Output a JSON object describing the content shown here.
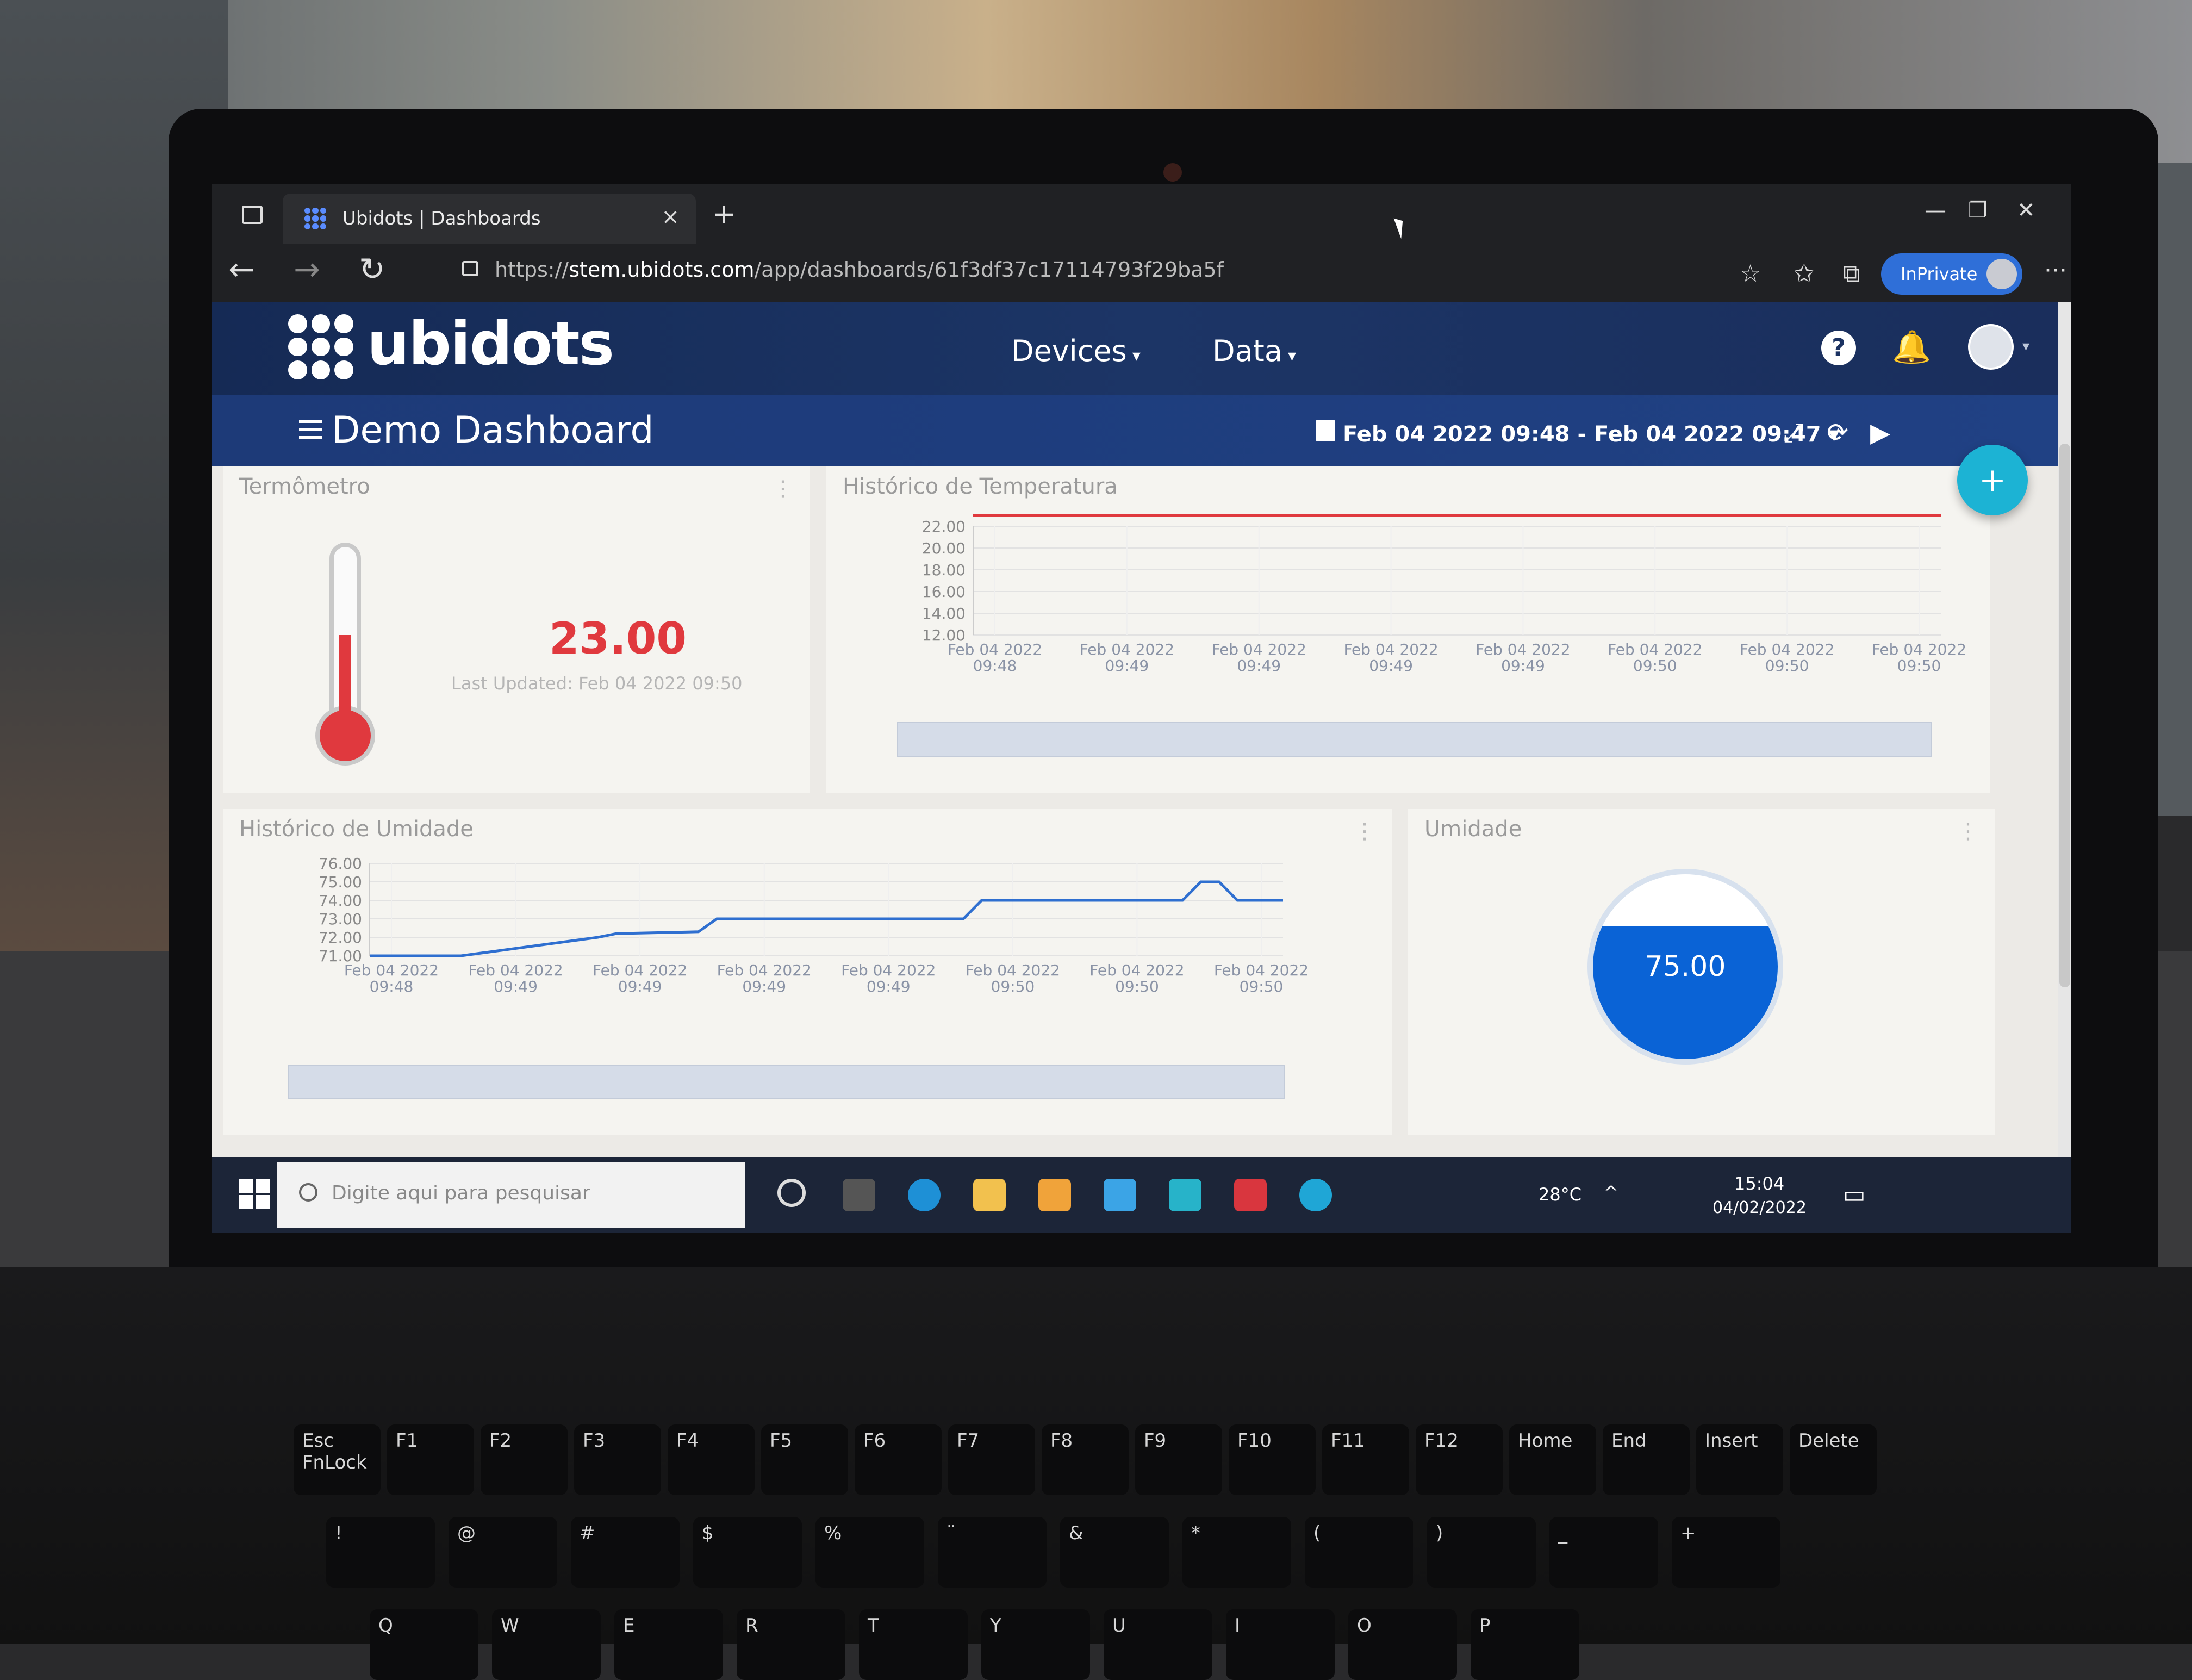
{
  "browser": {
    "tab_title": "Ubidots | Dashboards",
    "tab_close": "×",
    "new_tab": "+",
    "url_prefix": "https://",
    "url_host": "stem.ubidots.com",
    "url_path": "/app/dashboards/61f3df37c17114793f29ba5f",
    "inprivate_label": "InPrivate",
    "window_controls": {
      "minimize": "—",
      "restore": "❐",
      "close": "✕"
    },
    "back": "←",
    "forward": "→",
    "refresh": "↻",
    "more": "···"
  },
  "app": {
    "logo_text": "ubidots",
    "menu": [
      {
        "label": "Devices",
        "caret": "▾"
      },
      {
        "label": "Data",
        "caret": "▾"
      }
    ],
    "help": "?",
    "bell": "🔔",
    "avatar_caret": "▾"
  },
  "dashboard": {
    "title": "Demo Dashboard",
    "date_range": "Feb 04 2022 09:48 - Feb 04 2022 09:47",
    "date_caret": "▾",
    "expand": "⤢",
    "reload": "⟳",
    "play": "▶",
    "fab": "+"
  },
  "widgets": {
    "thermometer": {
      "title": "Termômetro",
      "value": "23.00",
      "last_updated": "Last Updated: Feb 04 2022 09:50"
    },
    "humidity": {
      "title": "Umidade",
      "value": "75.00",
      "fill_fraction": 0.72
    }
  },
  "chart_data": [
    {
      "type": "line",
      "title": "Histórico de Temperatura",
      "y_ticks": [
        "22.00",
        "20.00",
        "18.00",
        "16.00",
        "14.00",
        "12.00"
      ],
      "ylim": [
        12,
        22
      ],
      "x_ticks": [
        [
          "Feb 04 2022",
          "09:48"
        ],
        [
          "Feb 04 2022",
          "09:49"
        ],
        [
          "Feb 04 2022",
          "09:49"
        ],
        [
          "Feb 04 2022",
          "09:49"
        ],
        [
          "Feb 04 2022",
          "09:49"
        ],
        [
          "Feb 04 2022",
          "09:50"
        ],
        [
          "Feb 04 2022",
          "09:50"
        ],
        [
          "Feb 04 2022",
          "09:50"
        ]
      ],
      "series": [
        {
          "color": "#e0393e",
          "values": [
            23,
            23,
            23,
            23,
            23,
            23,
            23,
            23
          ]
        }
      ]
    },
    {
      "type": "line",
      "title": "Histórico de Umidade",
      "y_ticks": [
        "76.00",
        "75.00",
        "74.00",
        "73.00",
        "72.00",
        "71.00"
      ],
      "ylim": [
        71,
        76
      ],
      "x_ticks": [
        [
          "Feb 04 2022",
          "09:48"
        ],
        [
          "Feb 04 2022",
          "09:49"
        ],
        [
          "Feb 04 2022",
          "09:49"
        ],
        [
          "Feb 04 2022",
          "09:49"
        ],
        [
          "Feb 04 2022",
          "09:49"
        ],
        [
          "Feb 04 2022",
          "09:50"
        ],
        [
          "Feb 04 2022",
          "09:50"
        ],
        [
          "Feb 04 2022",
          "09:50"
        ]
      ],
      "series": [
        {
          "color": "#2f6fd0",
          "x": [
            0,
            0.1,
            0.25,
            0.27,
            0.36,
            0.38,
            0.65,
            0.67,
            0.89,
            0.91,
            0.93,
            0.95,
            0.97,
            1.0
          ],
          "values": [
            71,
            71,
            72,
            72.2,
            72.3,
            73,
            73,
            74,
            74,
            75,
            75,
            74,
            74,
            74
          ]
        }
      ]
    }
  ],
  "taskbar": {
    "search_placeholder": "Digite aqui para pesquisar",
    "weather": "28°C",
    "time": "15:04",
    "date": "04/02/2022"
  },
  "keyboard": {
    "fn_row": [
      [
        "Esc",
        "FnLock"
      ],
      [
        "",
        "F1"
      ],
      [
        "",
        "F2"
      ],
      [
        "",
        "F3"
      ],
      [
        "",
        "F4"
      ],
      [
        "",
        "F5"
      ],
      [
        "",
        "F6"
      ],
      [
        "",
        "F7"
      ],
      [
        "",
        "F8"
      ],
      [
        "",
        "F9"
      ],
      [
        "",
        "F10"
      ],
      [
        "",
        "F11"
      ],
      [
        "",
        "F12"
      ],
      [
        "Home",
        ""
      ],
      [
        "End",
        ""
      ],
      [
        "Insert",
        ""
      ],
      [
        "Delete",
        ""
      ]
    ],
    "num_row": [
      "!",
      "@",
      "#",
      "$",
      "%",
      "¨",
      "&",
      "*",
      "(",
      ")",
      "_",
      "+"
    ],
    "letters": [
      "Q",
      "W",
      "E",
      "R",
      "T",
      "Y",
      "U",
      "I",
      "O",
      "P"
    ]
  }
}
